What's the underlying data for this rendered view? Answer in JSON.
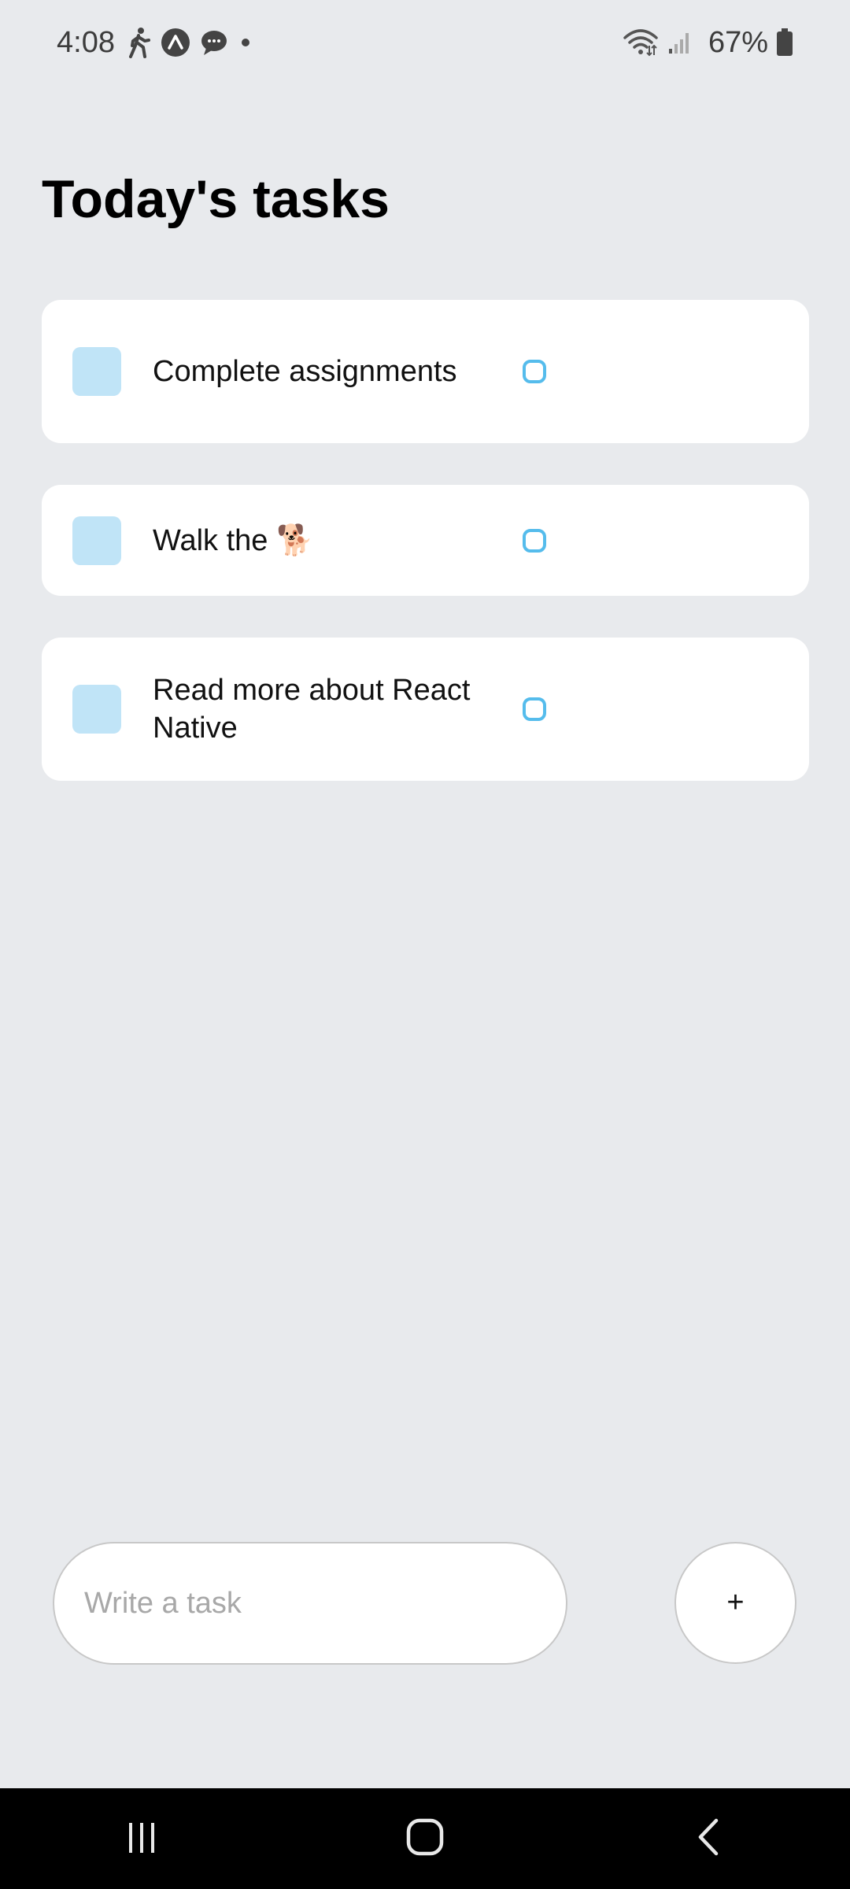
{
  "status_bar": {
    "time": "4:08",
    "battery": "67%",
    "icons": [
      "walking-icon",
      "a-app-icon",
      "chat-bubble-icon",
      "dot-icon",
      "wifi-icon",
      "signal-icon",
      "battery-icon"
    ]
  },
  "title": "Today's tasks",
  "tasks": [
    {
      "text": "Complete assignments"
    },
    {
      "text": "Walk the 🐕"
    },
    {
      "text": "Read more about React Native"
    }
  ],
  "input": {
    "placeholder": "Write a task",
    "value": ""
  },
  "add_button": {
    "label": "+"
  },
  "colors": {
    "background": "#e8eaed",
    "card": "#ffffff",
    "square": "#c0e4f7",
    "circle_border": "#55bcec"
  },
  "nav_bar": {
    "icons": [
      "recent-apps-icon",
      "home-icon",
      "back-icon"
    ]
  }
}
